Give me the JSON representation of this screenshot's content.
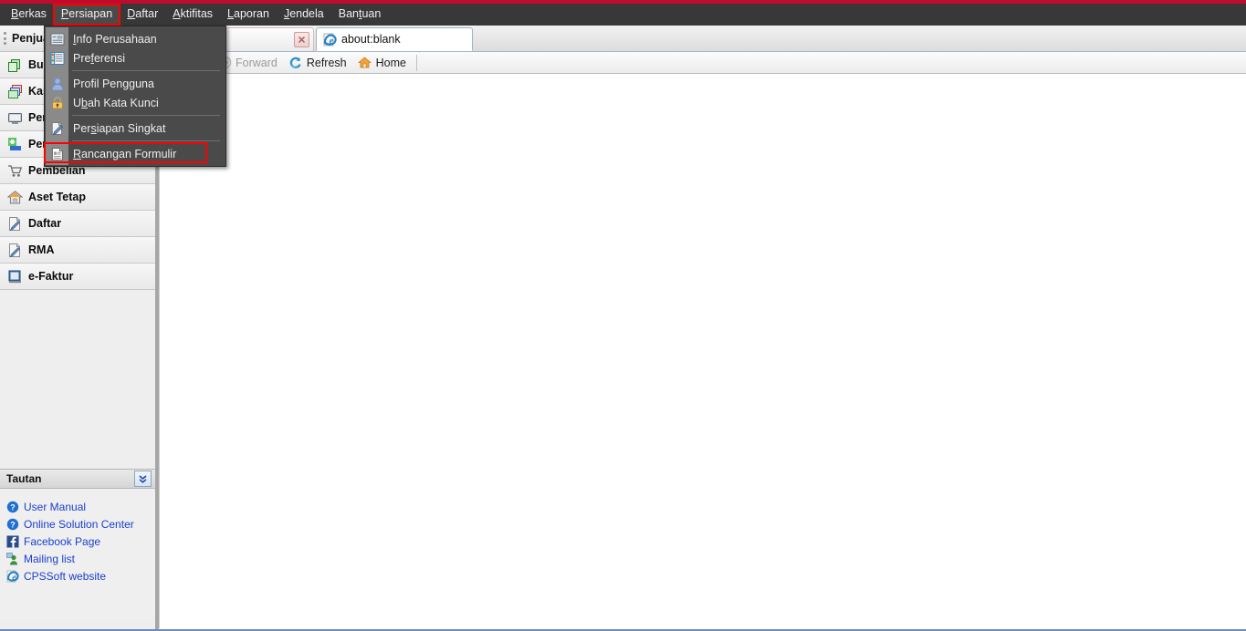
{
  "theme": {
    "accent_red": "#c00a2e",
    "menubar_bg": "#383838",
    "dropdown_bg": "#4a4a4a",
    "highlight_outline": "#ff0000",
    "link_color": "#1a3fcf"
  },
  "menubar": {
    "items": [
      {
        "label": "Berkas",
        "mnemonic": "B",
        "open": false
      },
      {
        "label": "Persiapan",
        "mnemonic": "P",
        "open": true
      },
      {
        "label": "Daftar",
        "mnemonic": "D",
        "open": false
      },
      {
        "label": "Aktifitas",
        "mnemonic": "A",
        "open": false
      },
      {
        "label": "Laporan",
        "mnemonic": "L",
        "open": false
      },
      {
        "label": "Jendela",
        "mnemonic": "J",
        "open": false
      },
      {
        "label": "Bantuan",
        "mnemonic": "B",
        "open": false
      }
    ]
  },
  "dropdown": {
    "owner": "Persiapan",
    "items": [
      {
        "label": "Info Perusahaan",
        "mnemonic": "I",
        "icon": "company-info-icon",
        "separator_after": false
      },
      {
        "label": "Preferensi",
        "mnemonic": "f",
        "icon": "preferences-icon",
        "separator_after": true
      },
      {
        "label": "Profil Pengguna",
        "mnemonic": "g",
        "icon": "user-profile-icon",
        "separator_after": false
      },
      {
        "label": "Ubah Kata Kunci",
        "mnemonic": "b",
        "icon": "lock-icon",
        "separator_after": true
      },
      {
        "label": "Persiapan Singkat",
        "mnemonic": "s",
        "icon": "quick-setup-icon",
        "separator_after": true
      },
      {
        "label": "Rancangan Formulir",
        "mnemonic": "R",
        "icon": "form-design-icon",
        "separator_after": false,
        "highlighted": true
      }
    ]
  },
  "sidebar": {
    "header": {
      "label": "Penjualan"
    },
    "items": [
      {
        "label": "Buku Besar",
        "icon": "ledger-icon"
      },
      {
        "label": "Kas & Bank",
        "icon": "cash-bank-icon"
      },
      {
        "label": "Persediaan",
        "icon": "inventory-icon"
      },
      {
        "label": "Penjualan",
        "icon": "sales-icon"
      },
      {
        "label": "Pembelian",
        "icon": "purchase-cart-icon"
      },
      {
        "label": "Aset Tetap",
        "icon": "fixed-asset-house-icon"
      },
      {
        "label": "Daftar",
        "icon": "list-pencil-icon"
      },
      {
        "label": "RMA",
        "icon": "rma-pencil-icon"
      },
      {
        "label": "e-Faktur",
        "icon": "e-invoice-book-icon"
      }
    ],
    "links_panel": {
      "title": "Tautan",
      "collapse_icon": "chevron-double-down-icon",
      "links": [
        {
          "label": "User Manual",
          "icon": "help-question-icon"
        },
        {
          "label": "Online Solution Center",
          "icon": "help-question-icon"
        },
        {
          "label": "Facebook Page",
          "icon": "facebook-icon"
        },
        {
          "label": "Mailing list",
          "icon": "mailing-list-icon"
        },
        {
          "label": "CPSSoft website",
          "icon": "internet-explorer-icon"
        }
      ]
    }
  },
  "browser": {
    "tabs": [
      {
        "title": "",
        "active": false,
        "close_icon": "close-icon"
      },
      {
        "title": "about:blank",
        "active": true,
        "icon": "internet-explorer-icon"
      }
    ],
    "toolbar": [
      {
        "label": "Forward",
        "icon": "forward-arrow-icon",
        "disabled": true
      },
      {
        "label": "Refresh",
        "icon": "refresh-icon",
        "disabled": false
      },
      {
        "label": "Home",
        "icon": "home-icon",
        "disabled": false
      }
    ]
  }
}
